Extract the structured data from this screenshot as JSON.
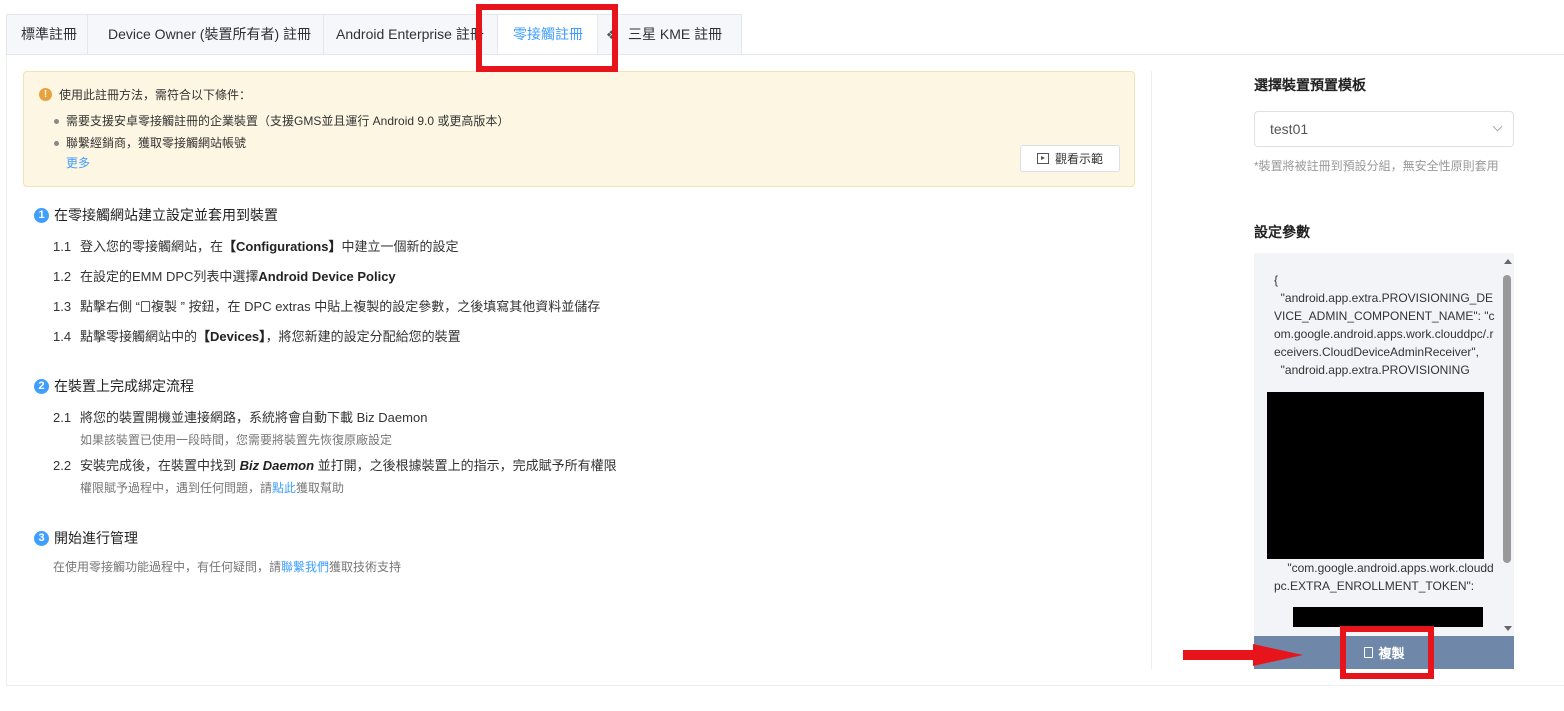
{
  "tabs": [
    {
      "label": "標準註冊",
      "active": false
    },
    {
      "label": "Device Owner (裝置所有者) 註冊",
      "active": false
    },
    {
      "label": "Android Enterprise 註冊",
      "active": false
    },
    {
      "label": "零接觸註冊",
      "active": true
    },
    {
      "label": "三星 KME 註冊",
      "active": false,
      "icon": "samsung-icon"
    }
  ],
  "notice": {
    "title": "使用此註冊方法，需符合以下條件：",
    "items": [
      "需要支援安卓零接觸註冊的企業裝置（支援GMS並且運行 Android 9.0 或更高版本）",
      "聯繫經銷商，獲取零接觸網站帳號"
    ],
    "more": "更多",
    "demo_button": "觀看示範"
  },
  "steps": {
    "s1": {
      "num": "1",
      "title": "在零接觸網站建立設定並套用到裝置",
      "i1": {
        "idx": "1.1",
        "pre": "登入您的零接觸網站，在",
        "bold": "【Configurations】",
        "post": "中建立一個新的設定"
      },
      "i2": {
        "idx": "1.2",
        "pre": "在設定的EMM DPC列表中選擇",
        "bold": "Android Device Policy"
      },
      "i3": {
        "idx": "1.3",
        "pre": "點擊右側 “",
        "copy": "複製",
        "post": " ” 按鈕，在 DPC extras 中貼上複製的設定參數，之後填寫其他資料並儲存"
      },
      "i4": {
        "idx": "1.4",
        "pre": "點擊零接觸網站中的",
        "bold": "【Devices】",
        "post": "，將您新建的設定分配給您的裝置"
      }
    },
    "s2": {
      "num": "2",
      "title": "在裝置上完成綁定流程",
      "i1": {
        "idx": "2.1",
        "text": "將您的裝置開機並連接網路，系統將會自動下載 Biz Daemon",
        "note": "如果該裝置已使用一段時間，您需要將裝置先恢復原廠設定"
      },
      "i2": {
        "idx": "2.2",
        "pre": "安裝完成後，在裝置中找到 ",
        "em": "Biz Daemon",
        "post": " 並打開，之後根據裝置上的指示，完成賦予所有權限",
        "note_pre": "權限賦予過程中，遇到任何問題，請",
        "note_link": "點此",
        "note_post": "獲取幫助"
      }
    },
    "s3": {
      "num": "3",
      "title": "開始進行管理",
      "pre": "在使用零接觸功能過程中，有任何疑問，請",
      "link": "聯繫我們",
      "post": "獲取技術支持"
    }
  },
  "right": {
    "template_label": "選擇裝置預置模板",
    "template_value": "test01",
    "hint": "*裝置將被註冊到預設分組，無安全性原則套用",
    "params_label": "設定參數",
    "code_text": "{\n  \"android.app.extra.PROVISIONING_DEVICE_ADMIN_COMPONENT_NAME\": \"com.google.android.apps.work.clouddpc/.receivers.CloudDeviceAdminReceiver\",\n  \"android.app.extra.PROVISIONING\n\n\n\n\n\n\n\n\n\nADMIN_EXTRAS_BUNDLE\": {\n    \"com.google.android.apps.work.clouddpc.EXTRA_ENROLLMENT_TOKEN\":",
    "copy_button": "複製"
  },
  "colors": {
    "accent": "#409eff",
    "highlight": "#e8141b",
    "copy_bar": "#6f87a8",
    "notice_bg": "#fdf6e3"
  }
}
